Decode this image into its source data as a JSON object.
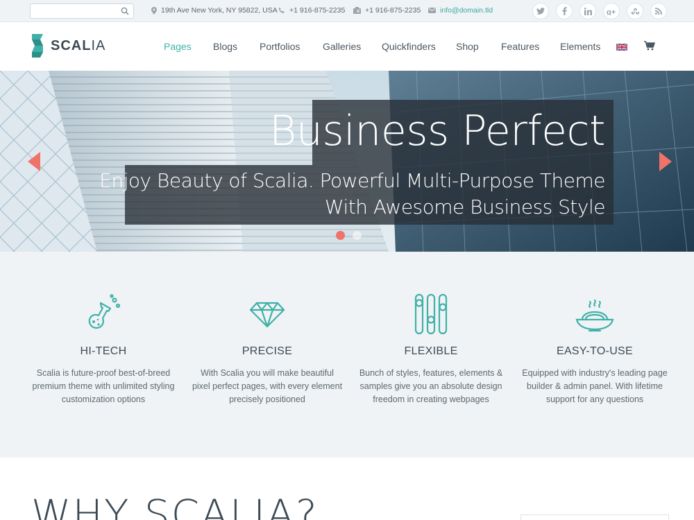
{
  "topbar": {
    "search": {
      "placeholder": "",
      "value": ""
    },
    "address": "19th Ave New York, NY 95822, USA",
    "phone": "+1 916-875-2235",
    "fax": "+1 916-875-2235",
    "email": "info@domain.tld",
    "social": [
      "twitter-icon",
      "facebook-icon",
      "linkedin-icon",
      "googleplus-icon",
      "stumbleupon-icon",
      "rss-icon"
    ]
  },
  "header": {
    "logo_bold": "SCAL",
    "logo_light": "IA",
    "nav": [
      "Pages",
      "Blogs",
      "Portfolios",
      "Galleries",
      "Quickfinders",
      "Shop",
      "Features",
      "Elements"
    ],
    "active_nav": "Pages"
  },
  "hero": {
    "title": "Business Perfect",
    "subtitle_line1": "Enjoy Beauty of Scalia. Powerful Multi-Purpose Theme",
    "subtitle_line2": "With Awesome Business Style",
    "active_slide": 1,
    "slide_count": 2
  },
  "features": [
    {
      "icon": "flask-icon",
      "title": "HI-TECH",
      "lines": [
        "Scalia is future-proof best-of-breed",
        "premium theme with unlimited styling",
        "customization options"
      ]
    },
    {
      "icon": "diamond-icon",
      "title": "PRECISE",
      "lines": [
        "With Scalia you will make beautiful",
        "pixel perfect pages, with every element",
        "precisely positioned"
      ]
    },
    {
      "icon": "sliders-icon",
      "title": "FLEXIBLE",
      "lines": [
        "Bunch of styles, features, elements &",
        "samples give you an absolute design",
        "freedom in creating webpages"
      ]
    },
    {
      "icon": "noodle-bowl-icon",
      "title": "EASY-TO-USE",
      "lines": [
        "Equipped with industry's leading page",
        "builder & admin panel. With lifetime",
        "support for any questions"
      ]
    }
  ],
  "why": {
    "title": "WHY SCALIA?"
  },
  "colors": {
    "accent": "#3fb1a8",
    "arrow": "#f0736b",
    "text": "#3d4a54",
    "band": "#f0f3f5"
  }
}
